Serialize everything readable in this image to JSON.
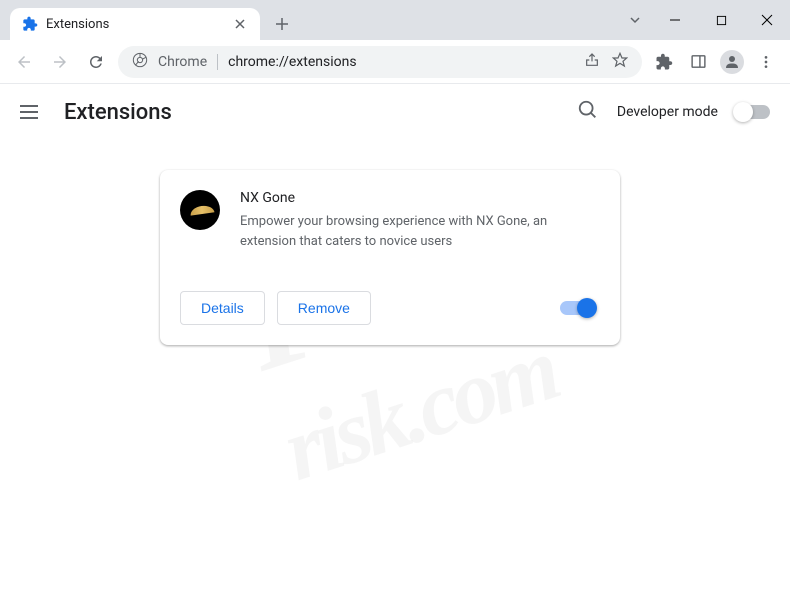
{
  "tab": {
    "title": "Extensions"
  },
  "omnibox": {
    "chrome_label": "Chrome",
    "url": "chrome://extensions"
  },
  "page": {
    "title": "Extensions",
    "dev_mode_label": "Developer mode"
  },
  "extension": {
    "name": "NX Gone",
    "description": "Empower your browsing experience with NX Gone, an extension that caters to novice users",
    "details_label": "Details",
    "remove_label": "Remove"
  },
  "watermark": {
    "line1": "PC",
    "line2": "risk.com"
  }
}
